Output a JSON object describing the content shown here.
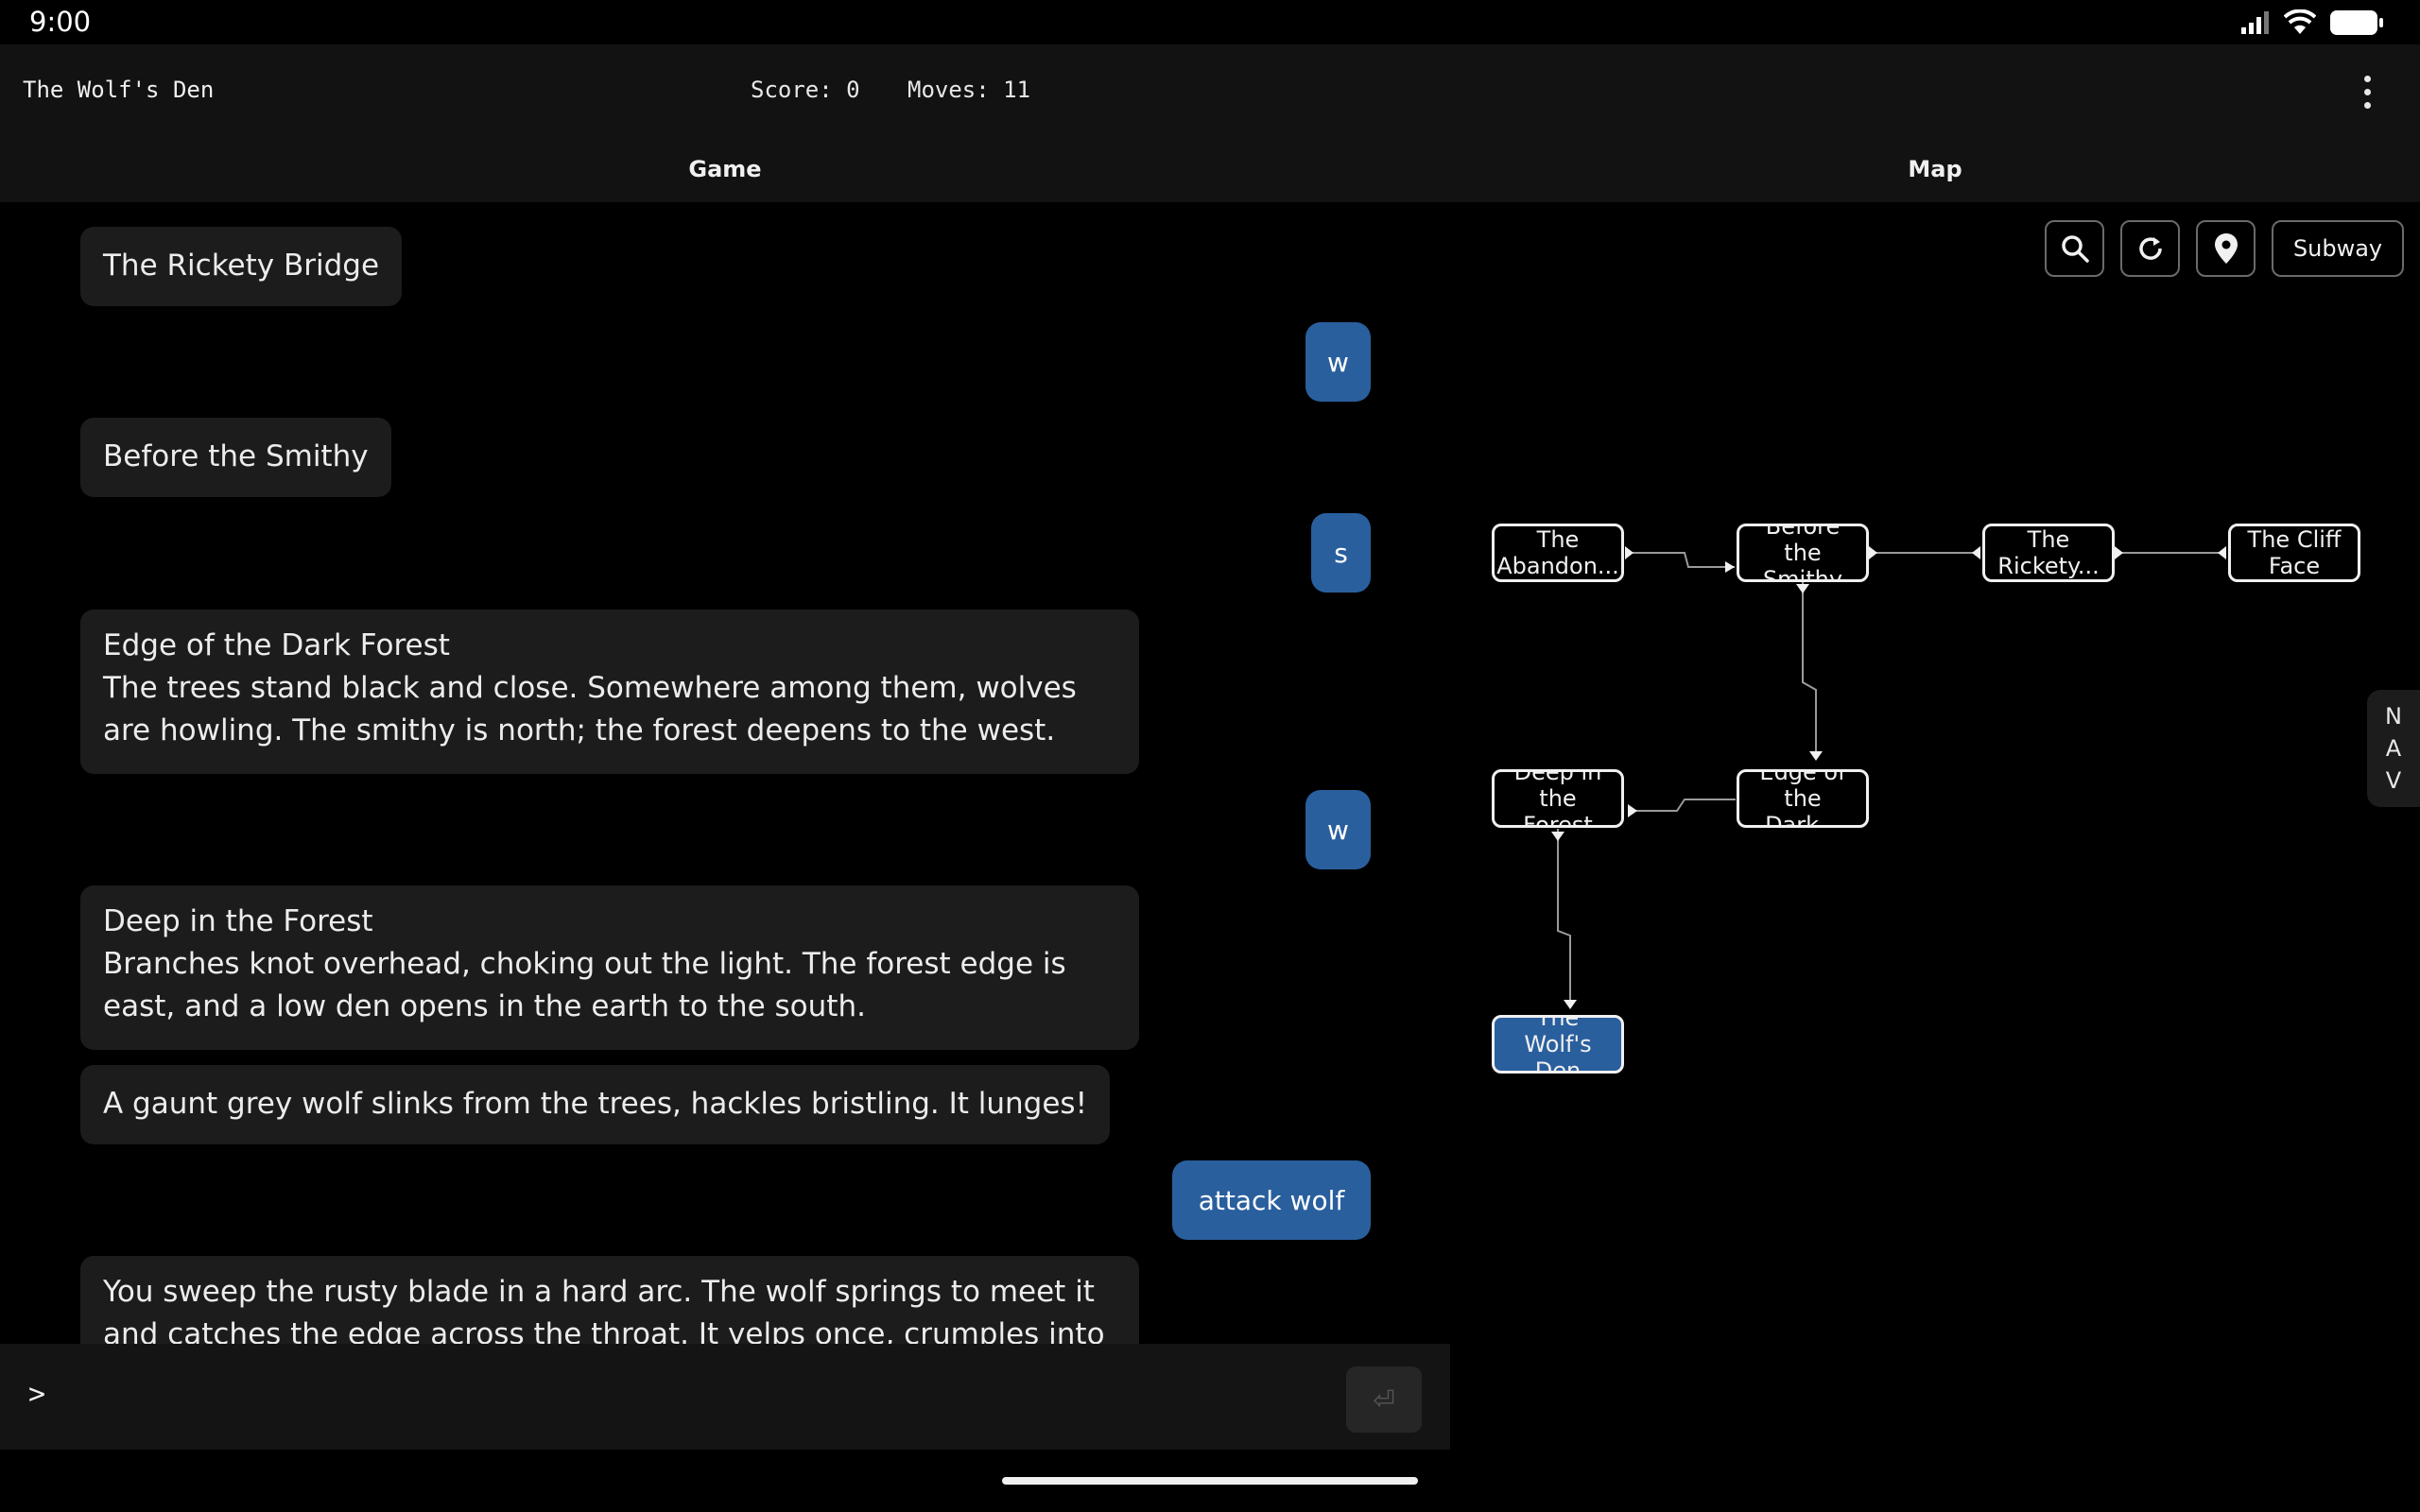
{
  "status_bar": {
    "time": "9:00"
  },
  "header": {
    "title": "The Wolf's Den",
    "score": "Score: 0",
    "moves": "Moves: 11"
  },
  "tabs": {
    "game": "Game",
    "map": "Map"
  },
  "transcript": {
    "rickety_bridge": "The Rickety Bridge",
    "cmd_w1": "w",
    "before_smithy": "Before the Smithy",
    "cmd_s": "s",
    "edge_title": "Edge of the Dark Forest",
    "edge_desc": "The trees stand black and close. Somewhere among them, wolves are howling. The smithy is north; the forest deepens to the west.",
    "cmd_w2": "w",
    "deep_title": "Deep in the Forest",
    "deep_desc": "Branches knot overhead, choking out the light. The forest edge is east, and a low den opens in the earth to the south.",
    "wolf_event": "A gaunt grey wolf slinks from the trees, hackles bristling. It lunges!",
    "cmd_attack": "attack wolf",
    "attack_result": "You sweep the rusty blade in a hard arc. The wolf springs to meet it and catches the edge across the throat. It yelps once, crumples into the"
  },
  "input": {
    "prompt": ">",
    "placeholder": "",
    "send_icon": "enter-icon"
  },
  "map": {
    "toolbar": {
      "search_icon": "search-icon",
      "refresh_icon": "refresh-icon",
      "locate_icon": "location-pin-icon",
      "subway_label": "Subway"
    },
    "nav_label": [
      "N",
      "A",
      "V"
    ],
    "nodes": {
      "abandoned": {
        "line1": "The",
        "line2": "Abandon..."
      },
      "smithy": {
        "line1": "Before the",
        "line2": "Smithy"
      },
      "rickety": {
        "line1": "The",
        "line2": "Rickety..."
      },
      "cliff": {
        "line1": "The Cliff",
        "line2": "Face"
      },
      "deep": {
        "line1": "Deep in",
        "line2": "the Forest"
      },
      "edge": {
        "line1": "Edge of",
        "line2": "the Dark..."
      },
      "wolfs_den": {
        "line1": "The Wolf's",
        "line2": "Den",
        "current": true
      }
    },
    "colors": {
      "current_room": "#2a5f9e",
      "node_border": "#f0f0f0",
      "link": "#9a9a9a"
    }
  },
  "colors": {
    "command_bubble": "#2a5f9e",
    "message_bubble": "#1c1c1c",
    "background": "#000000"
  }
}
